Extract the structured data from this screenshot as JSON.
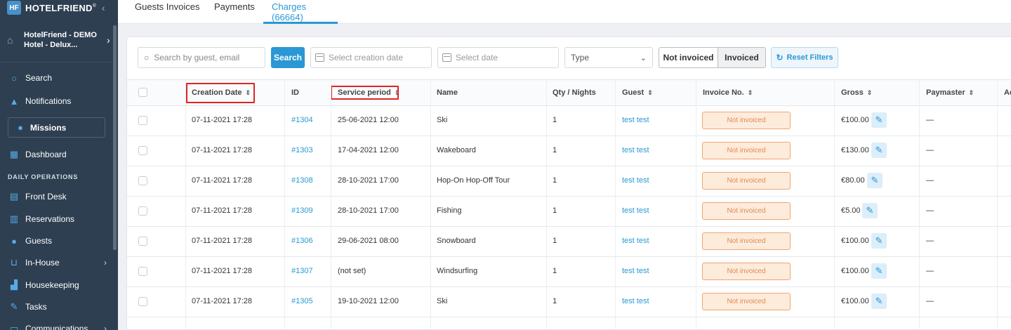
{
  "sidebar": {
    "brand": "HOTELFRIEND",
    "brand_logo": "HF",
    "brand_trademark": "®",
    "hotel_line1": "HotelFriend - DEMO",
    "hotel_line2": "Hotel - Delux...",
    "items": [
      {
        "label": "Search",
        "icon": "search-icon"
      },
      {
        "label": "Notifications",
        "icon": "bell-icon"
      },
      {
        "label": "Missions",
        "icon": "missions-icon"
      },
      {
        "label": "Dashboard",
        "icon": "dashboard-icon"
      },
      {
        "label": "Front Desk",
        "icon": "front-desk-icon"
      },
      {
        "label": "Reservations",
        "icon": "reservations-icon"
      },
      {
        "label": "Guests",
        "icon": "guests-icon"
      },
      {
        "label": "In-House",
        "icon": "cart-icon"
      },
      {
        "label": "Housekeeping",
        "icon": "housekeeping-icon"
      },
      {
        "label": "Tasks",
        "icon": "wrench-icon"
      },
      {
        "label": "Communications",
        "icon": "chat-icon"
      }
    ],
    "section_daily": "DAILY OPERATIONS"
  },
  "tabs": [
    {
      "label": "Guests Invoices",
      "active": false
    },
    {
      "label": "Payments",
      "active": false
    },
    {
      "label": "Charges (66664)",
      "active": true
    }
  ],
  "filters": {
    "search_placeholder": "Search by guest, email",
    "search_button": "Search",
    "creation_date_placeholder": "Select creation date",
    "date_placeholder": "Select date",
    "type_placeholder": "Type",
    "toggle_not_invoiced": "Not invoiced",
    "toggle_invoiced": "Invoiced",
    "reset_label": "Reset Filters"
  },
  "table": {
    "headers": {
      "creation_date": "Creation Date",
      "id": "ID",
      "service_period": "Service period",
      "name": "Name",
      "qty": "Qty / Nights",
      "guest": "Guest",
      "invoice_no": "Invoice No.",
      "gross": "Gross",
      "paymaster": "Paymaster",
      "actions": "Ac"
    },
    "rows": [
      {
        "creation": "07-11-2021 17:28",
        "id": "#1304",
        "period": "25-06-2021 12:00",
        "name": "Ski",
        "qty": "1",
        "guest": "test test",
        "invoice": "Not invoiced",
        "gross": "€100.00",
        "paymaster": "—"
      },
      {
        "creation": "07-11-2021 17:28",
        "id": "#1303",
        "period": "17-04-2021 12:00",
        "name": "Wakeboard",
        "qty": "1",
        "guest": "test test",
        "invoice": "Not invoiced",
        "gross": "€130.00",
        "paymaster": "—"
      },
      {
        "creation": "07-11-2021 17:28",
        "id": "#1308",
        "period": "28-10-2021 17:00",
        "name": "Hop-On Hop-Off Tour",
        "qty": "1",
        "guest": "test test",
        "invoice": "Not invoiced",
        "gross": "€80.00",
        "paymaster": "—"
      },
      {
        "creation": "07-11-2021 17:28",
        "id": "#1309",
        "period": "28-10-2021 17:00",
        "name": "Fishing",
        "qty": "1",
        "guest": "test test",
        "invoice": "Not invoiced",
        "gross": "€5.00",
        "paymaster": "—"
      },
      {
        "creation": "07-11-2021 17:28",
        "id": "#1306",
        "period": "29-06-2021 08:00",
        "name": "Snowboard",
        "qty": "1",
        "guest": "test test",
        "invoice": "Not invoiced",
        "gross": "€100.00",
        "paymaster": "—"
      },
      {
        "creation": "07-11-2021 17:28",
        "id": "#1307",
        "period": "(not set)",
        "name": "Windsurfing",
        "qty": "1",
        "guest": "test test",
        "invoice": "Not invoiced",
        "gross": "€100.00",
        "paymaster": "—"
      },
      {
        "creation": "07-11-2021 17:28",
        "id": "#1305",
        "period": "19-10-2021 12:00",
        "name": "Ski",
        "qty": "1",
        "guest": "test test",
        "invoice": "Not invoiced",
        "gross": "€100.00",
        "paymaster": "—"
      }
    ]
  },
  "colors": {
    "accent": "#2a98d4",
    "sidebar_bg": "#2d3f50",
    "badge_border": "#f3a66e",
    "badge_bg": "#fdebdc",
    "highlight": "#e02424"
  }
}
